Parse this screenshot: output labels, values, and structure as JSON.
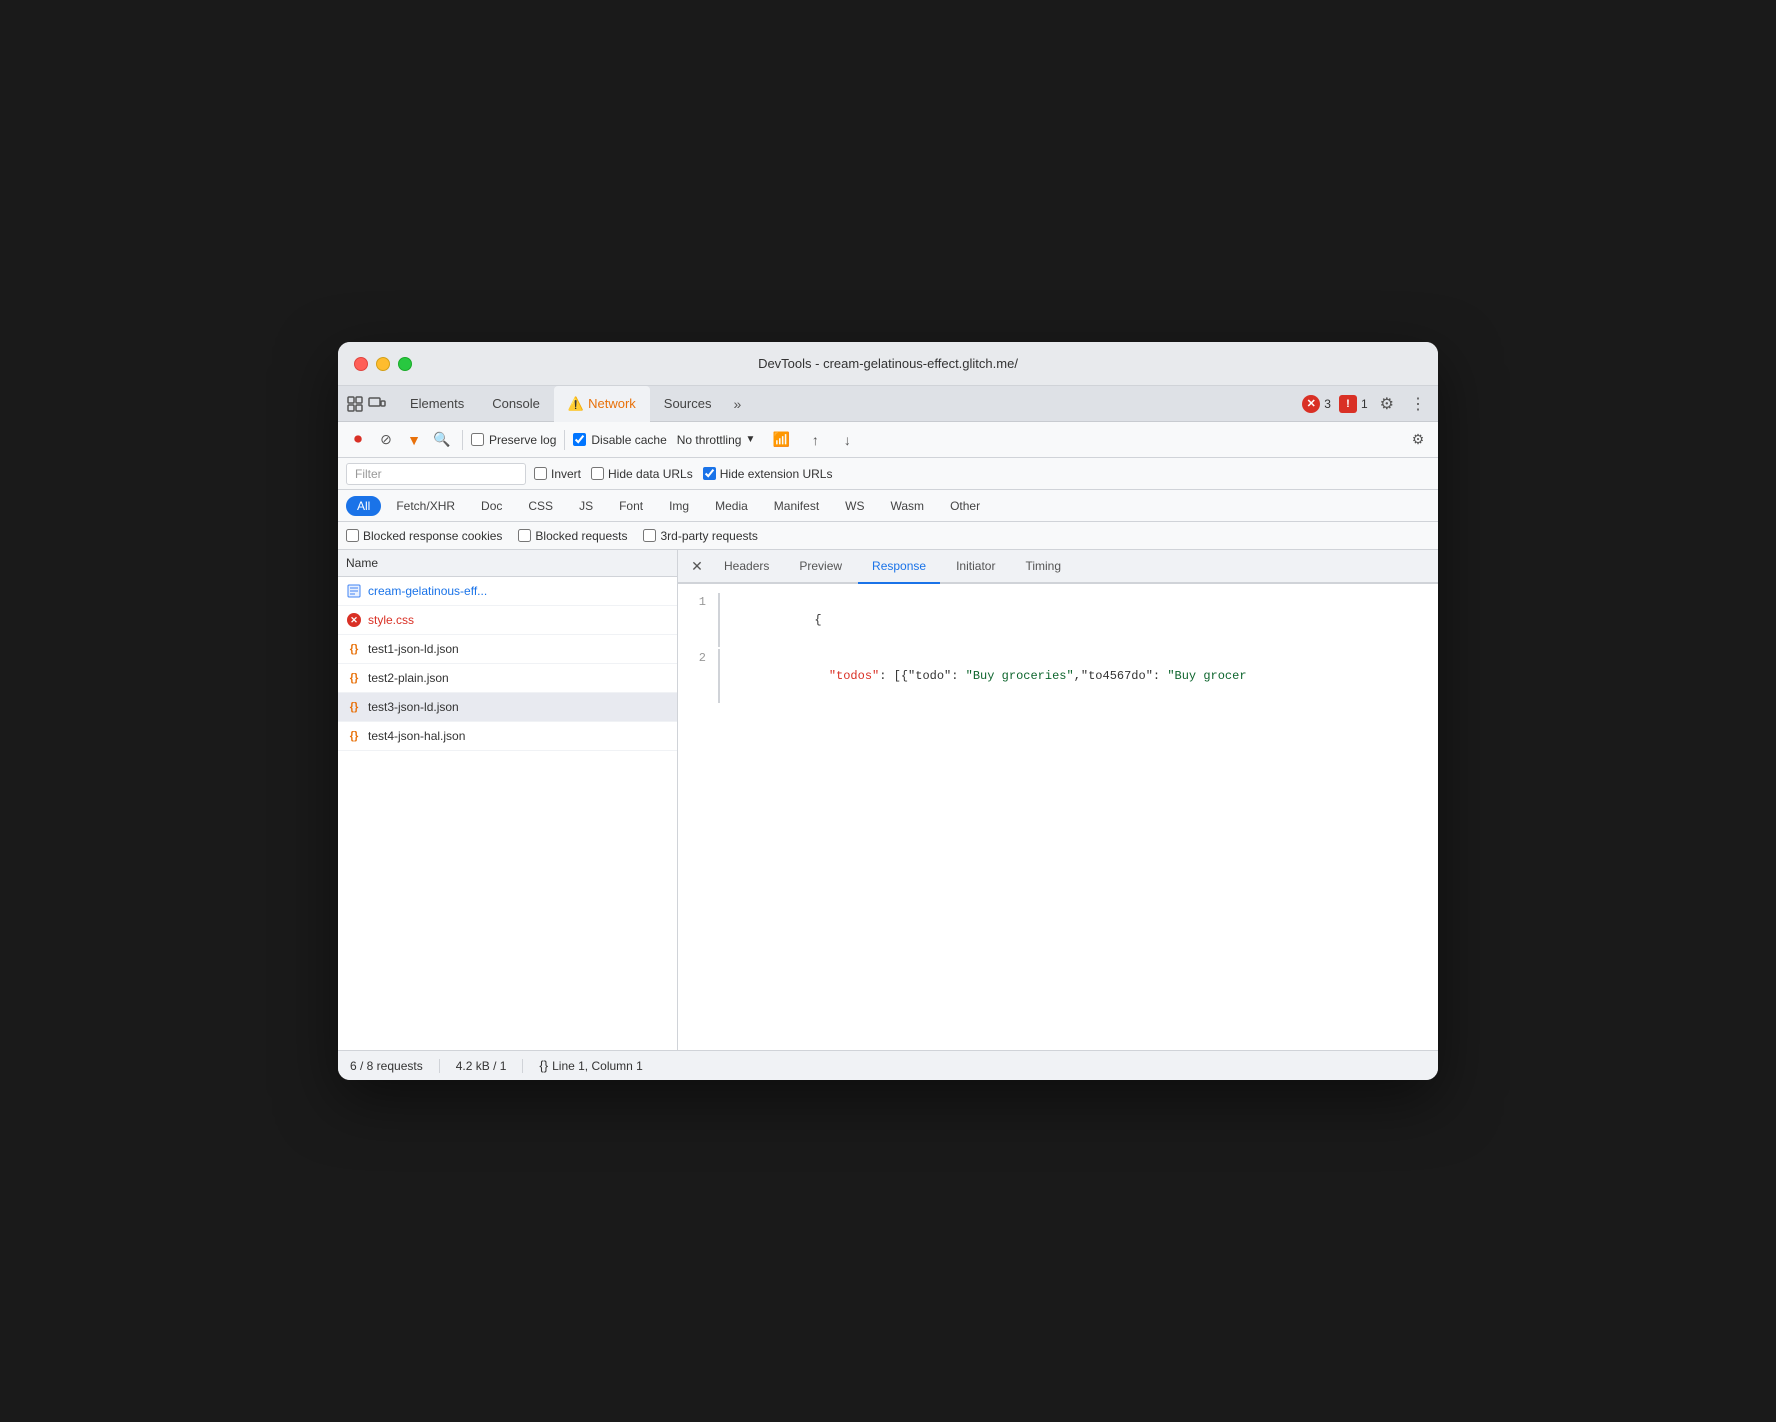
{
  "window": {
    "title": "DevTools - cream-gelatinous-effect.glitch.me/"
  },
  "tabs": {
    "items": [
      {
        "label": "Elements",
        "active": false
      },
      {
        "label": "Console",
        "active": false
      },
      {
        "label": "Network",
        "active": true,
        "hasWarning": true
      },
      {
        "label": "Sources",
        "active": false
      }
    ],
    "more_label": "»"
  },
  "toolbar": {
    "preserve_log": "Preserve log",
    "disable_cache": "Disable cache",
    "no_throttling": "No throttling",
    "disable_cache_checked": true,
    "preserve_log_checked": false
  },
  "filter": {
    "placeholder": "Filter",
    "invert_label": "Invert",
    "hide_data_urls_label": "Hide data URLs",
    "hide_ext_urls_label": "Hide extension URLs",
    "hide_ext_urls_checked": true,
    "invert_checked": false,
    "hide_data_urls_checked": false
  },
  "type_filters": [
    {
      "label": "All",
      "active": true
    },
    {
      "label": "Fetch/XHR",
      "active": false
    },
    {
      "label": "Doc",
      "active": false
    },
    {
      "label": "CSS",
      "active": false
    },
    {
      "label": "JS",
      "active": false
    },
    {
      "label": "Font",
      "active": false
    },
    {
      "label": "Img",
      "active": false
    },
    {
      "label": "Media",
      "active": false
    },
    {
      "label": "Manifest",
      "active": false
    },
    {
      "label": "WS",
      "active": false
    },
    {
      "label": "Wasm",
      "active": false
    },
    {
      "label": "Other",
      "active": false
    }
  ],
  "extras": {
    "blocked_cookies": "Blocked response cookies",
    "blocked_requests": "Blocked requests",
    "third_party": "3rd-party requests"
  },
  "file_list": {
    "header": "Name",
    "items": [
      {
        "name": "cream-gelatinous-eff...",
        "type": "doc",
        "selected": false
      },
      {
        "name": "style.css",
        "type": "error",
        "selected": false
      },
      {
        "name": "test1-json-ld.json",
        "type": "json",
        "selected": false
      },
      {
        "name": "test2-plain.json",
        "type": "json",
        "selected": false
      },
      {
        "name": "test3-json-ld.json",
        "type": "json",
        "selected": true
      },
      {
        "name": "test4-json-hal.json",
        "type": "json",
        "selected": false
      }
    ]
  },
  "detail_panel": {
    "tabs": [
      {
        "label": "Headers",
        "active": false
      },
      {
        "label": "Preview",
        "active": false
      },
      {
        "label": "Response",
        "active": true
      },
      {
        "label": "Initiator",
        "active": false
      },
      {
        "label": "Timing",
        "active": false
      }
    ],
    "code_lines": [
      {
        "num": "1",
        "content": "{",
        "type": "brace"
      },
      {
        "num": "2",
        "content_parts": [
          {
            "text": "  \"todos\": [{\"todo\": \"Buy groceries\",\"to4567do\": \"Buy grocer",
            "type": "mixed"
          }
        ]
      }
    ]
  },
  "status_bar": {
    "requests": "6 / 8 requests",
    "size": "4.2 kB / 1",
    "position": "Line 1, Column 1"
  },
  "error_counts": {
    "errors": "3",
    "warnings": "1"
  }
}
